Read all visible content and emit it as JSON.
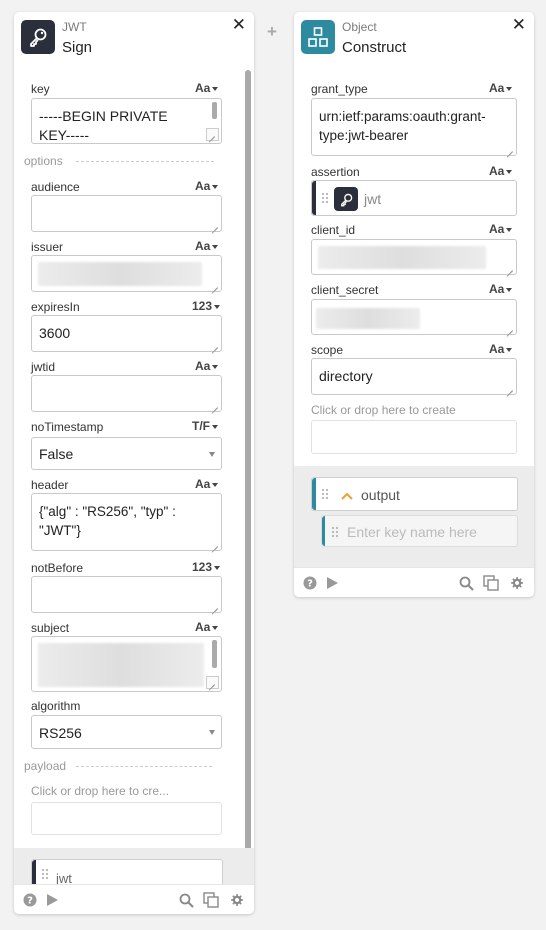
{
  "add_label": "+",
  "close_label": "✕",
  "jwt_card": {
    "type_label": "JWT",
    "title": "Sign",
    "icon": "key-icon",
    "icon_bg": "#2b2e3b",
    "fields": {
      "key": {
        "label": "key",
        "type": "Aa",
        "value": "-----BEGIN PRIVATE KEY-----"
      },
      "audience": {
        "label": "audience",
        "type": "Aa",
        "value": ""
      },
      "issuer": {
        "label": "issuer",
        "type": "Aa",
        "value": ""
      },
      "expiresIn": {
        "label": "expiresIn",
        "type": "123",
        "value": "3600"
      },
      "jwtid": {
        "label": "jwtid",
        "type": "Aa",
        "value": ""
      },
      "noTimestamp": {
        "label": "noTimestamp",
        "type": "T/F",
        "value": "False"
      },
      "header": {
        "label": "header",
        "type": "Aa",
        "value": "{\"alg\" : \"RS256\", \"typ\" : \"JWT\"}"
      },
      "notBefore": {
        "label": "notBefore",
        "type": "123",
        "value": ""
      },
      "subject": {
        "label": "subject",
        "type": "Aa",
        "value": ""
      },
      "algorithm": {
        "label": "algorithm",
        "value": "RS256"
      }
    },
    "options_label": "options",
    "payload_label": "payload",
    "payload_placeholder": "Click or drop here to cre...",
    "output_label": "jwt"
  },
  "object_card": {
    "type_label": "Object",
    "title": "Construct",
    "icon": "construct-icon",
    "icon_bg": "#2e8b9f",
    "fields": {
      "grant_type": {
        "label": "grant_type",
        "type": "Aa",
        "value": "urn:ietf:params:oauth:grant-type:jwt-bearer"
      },
      "assertion": {
        "label": "assertion",
        "type": "Aa",
        "ref": "jwt"
      },
      "client_id": {
        "label": "client_id",
        "type": "Aa",
        "value": ""
      },
      "client_secret": {
        "label": "client_secret",
        "type": "Aa",
        "value": ""
      },
      "scope": {
        "label": "scope",
        "type": "Aa",
        "value": "directory"
      }
    },
    "create_placeholder": "Click or drop here to create",
    "output_label": "output",
    "key_placeholder": "Enter key name here"
  },
  "footer_icons": [
    "help-icon",
    "play-icon",
    "search-icon",
    "copy-icon",
    "gear-icon"
  ]
}
